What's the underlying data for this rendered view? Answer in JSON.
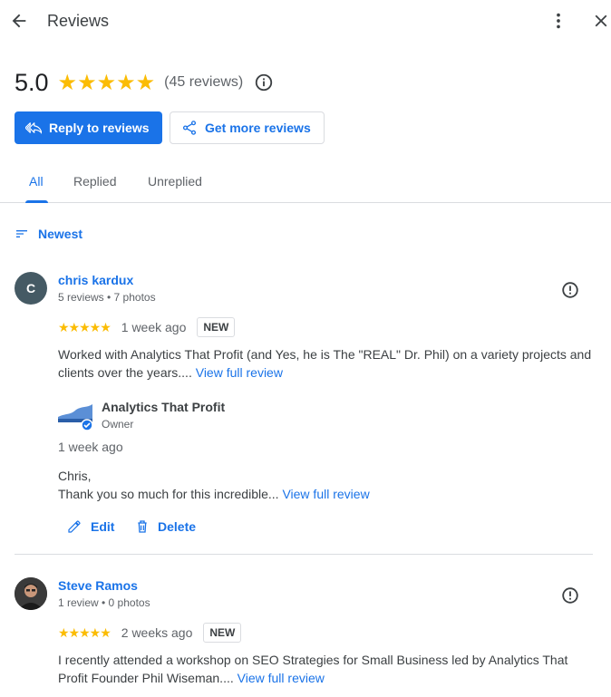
{
  "header": {
    "title": "Reviews"
  },
  "summary": {
    "rating": "5.0",
    "stars": "★★★★★",
    "count_text": "(45 reviews)"
  },
  "buttons": {
    "reply": "Reply to reviews",
    "get_more": "Get more reviews"
  },
  "tabs": [
    {
      "label": "All"
    },
    {
      "label": "Replied"
    },
    {
      "label": "Unreplied"
    }
  ],
  "sort": {
    "label": "Newest"
  },
  "reviews": [
    {
      "avatar_initial": "C",
      "name": "chris kardux",
      "meta": "5 reviews • 7 photos",
      "stars": "★★★★★",
      "ago": "1 week ago",
      "badge": "NEW",
      "text": "Worked with Analytics That Profit (and Yes, he is The \"REAL\" Dr. Phil) on a variety projects and clients over the years....",
      "link": "View full review",
      "reply": {
        "owner_name": "Analytics That Profit",
        "owner_role": "Owner",
        "ago": "1 week ago",
        "greeting": "Chris,",
        "text": "Thank you so much for this incredible...",
        "link": "View full review",
        "edit": "Edit",
        "delete": "Delete"
      }
    },
    {
      "name": "Steve Ramos",
      "meta": "1 review • 0 photos",
      "stars": "★★★★★",
      "ago": "2 weeks ago",
      "badge": "NEW",
      "text": "I recently attended a workshop on SEO Strategies for Small Business led by Analytics That Profit Founder Phil Wiseman....",
      "link": "View full review"
    }
  ],
  "colors": {
    "accent": "#1a73e8",
    "star": "#fbbc04",
    "avatar_bg": "#455a64"
  }
}
